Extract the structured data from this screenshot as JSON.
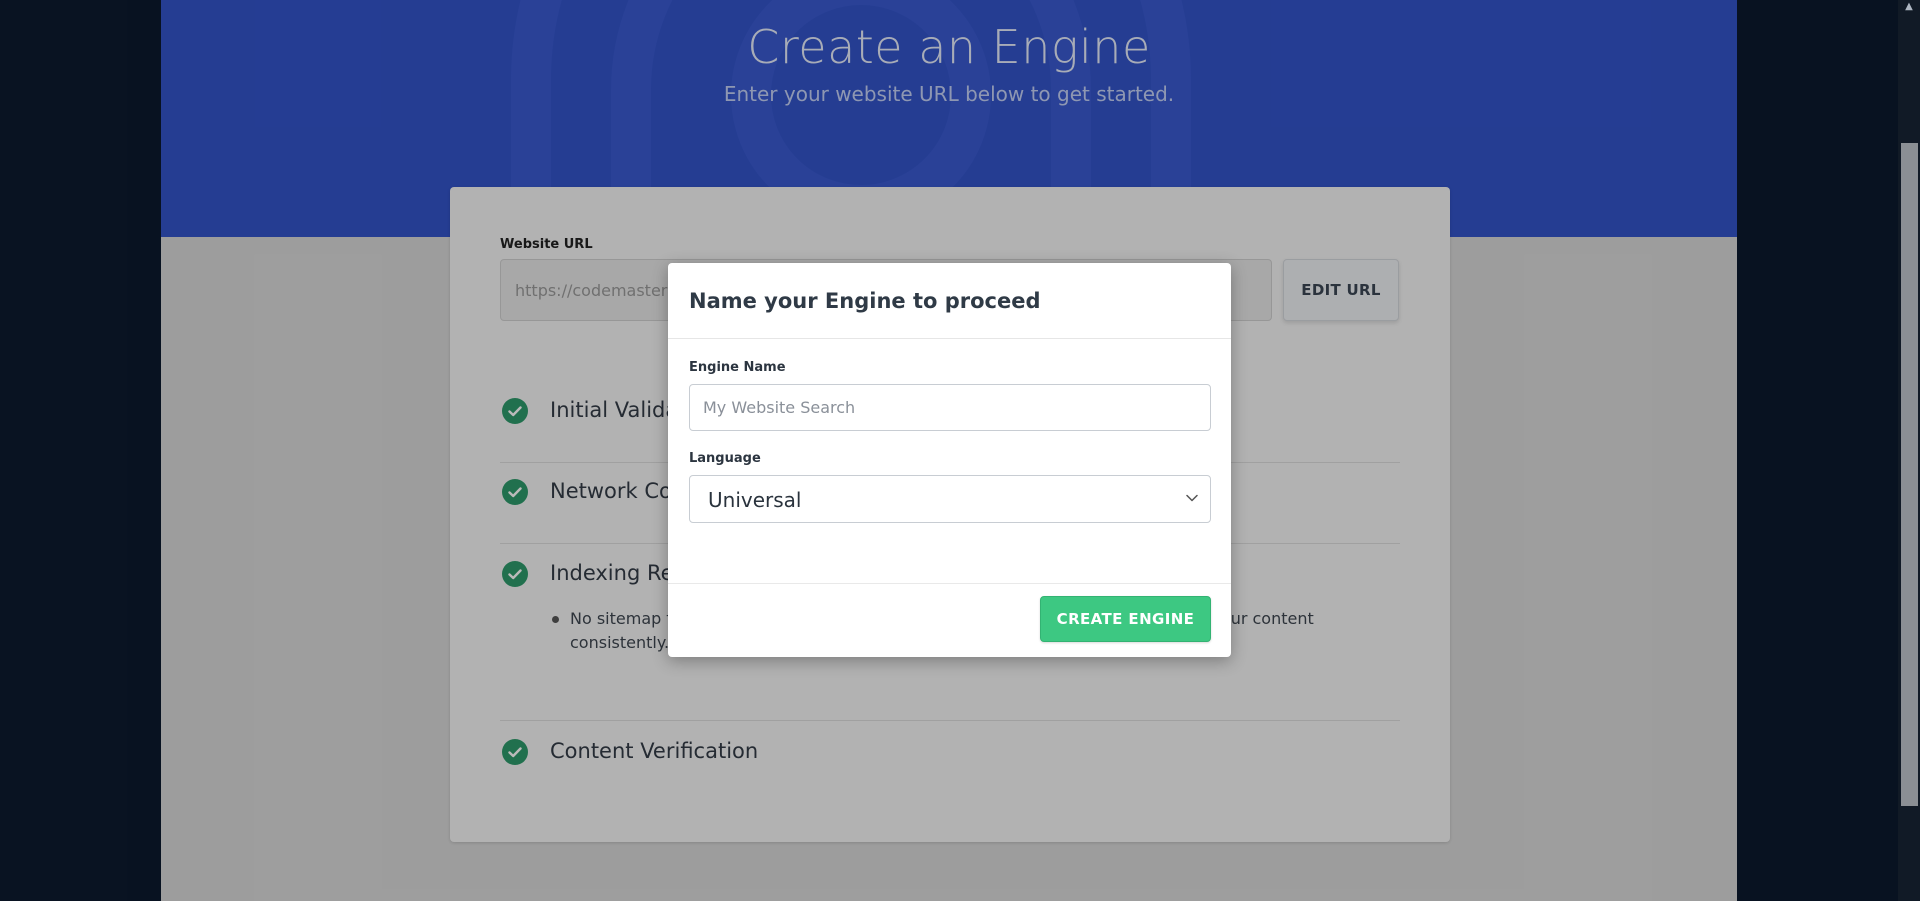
{
  "hero": {
    "title": "Create an Engine",
    "subtitle": "Enter your website URL below to get started."
  },
  "website_url": {
    "label": "Website URL",
    "value": "https://codemaster2",
    "edit_button_label": "EDIT URL"
  },
  "steps": [
    {
      "title": "Initial Validation",
      "status": "complete"
    },
    {
      "title": "Network Connectivity",
      "status": "complete"
    },
    {
      "title": "Indexing Restrictions",
      "status": "complete",
      "note": "No sitemap found. A sitemap is not required, but having one will help us to find your content consistently."
    },
    {
      "title": "Content Verification",
      "status": "complete"
    }
  ],
  "modal": {
    "title": "Name your Engine to proceed",
    "engine_name_label": "Engine Name",
    "engine_name_placeholder": "My Website Search",
    "engine_name_value": "",
    "language_label": "Language",
    "language_value": "Universal",
    "create_button_label": "CREATE ENGINE"
  },
  "colors": {
    "hero_background": "#3354c9",
    "success_green": "#3dc882",
    "check_icon": "#2e9a6b",
    "outer_background": "#0c1a2e"
  },
  "icons": {
    "step_status": "check-circle-icon",
    "language_dropdown": "chevron-down-icon",
    "scroll_up": "arrow-up-icon"
  }
}
